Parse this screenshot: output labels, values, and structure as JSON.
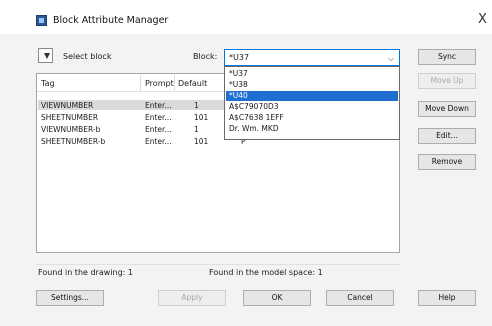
{
  "window": {
    "title": "Block Attribute Manager",
    "close_glyph": "X"
  },
  "toolbar": {
    "select_block_label": "Select block",
    "block_label": "Block:",
    "block_value": "*U37",
    "dropdown_options": [
      "*U37",
      "*U38",
      "*U40",
      "A$C79070D3",
      "A$C7638 1EFF",
      "Dr. Wm. MKD"
    ],
    "dropdown_selected_index": 2
  },
  "table": {
    "columns": [
      "Tag",
      "Prompt",
      "Default"
    ],
    "rows": [
      {
        "tag": "VIEWNUMBER",
        "prompt": "Enter...",
        "default": "1",
        "mode": ""
      },
      {
        "tag": "SHEETNUMBER",
        "prompt": "Enter...",
        "default": "101",
        "mode": ""
      },
      {
        "tag": "VIEWNUMBER-b",
        "prompt": "Enter...",
        "default": "1",
        "mode": "P"
      },
      {
        "tag": "SHEETNUMBER-b",
        "prompt": "Enter...",
        "default": "101",
        "mode": "P"
      }
    ],
    "selected_row": 0
  },
  "status": {
    "found_drawing": "Found in the drawing: 1",
    "found_model_space": "Found in the model space: 1"
  },
  "side_buttons": {
    "sync": "Sync",
    "move_up": "Move Up",
    "move_down": "Move Down",
    "edit": "Edit...",
    "remove": "Remove"
  },
  "bottom_buttons": {
    "settings": "Settings...",
    "apply": "Apply",
    "ok": "OK",
    "cancel": "Cancel",
    "help": "Help"
  },
  "colors": {
    "selection_blue": "#1e6fcf",
    "focus_border": "#0078d7",
    "row_selected": "#dadada"
  },
  "icons": {
    "app": "block-attribute-icon",
    "select_block": "pick-cursor-icon",
    "combo": "chevron-down-icon"
  }
}
